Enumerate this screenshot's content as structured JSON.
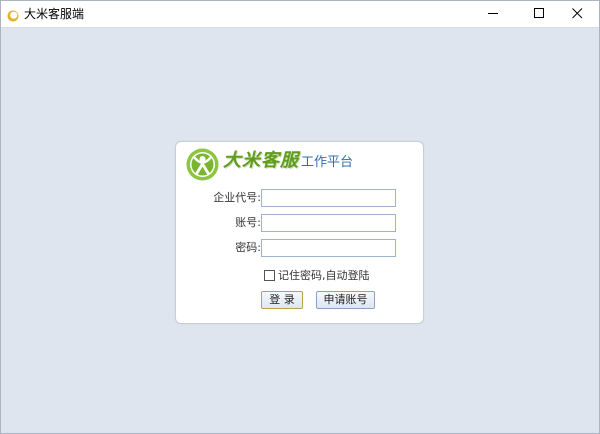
{
  "window": {
    "title": "大米客服端",
    "controls": {
      "minimize": "minimize-icon",
      "maximize": "maximize-icon",
      "close": "close-icon"
    }
  },
  "brand": {
    "name": "大米客服",
    "subtitle": "工作平台",
    "accent_color": "#5f9b1d",
    "subtitle_color": "#2f6fb0"
  },
  "form": {
    "company_code_label": "企业代号:",
    "company_code_value": "",
    "account_label": "账号:",
    "account_value": "",
    "password_label": "密码:",
    "password_value": "",
    "remember_label": "记住密码,自动登陆",
    "remember_checked": false
  },
  "buttons": {
    "login": "登 录",
    "apply": "申请账号"
  },
  "colors": {
    "background": "#dfe5ee",
    "card": "#ffffff",
    "input_border": "#9eb3cc"
  }
}
